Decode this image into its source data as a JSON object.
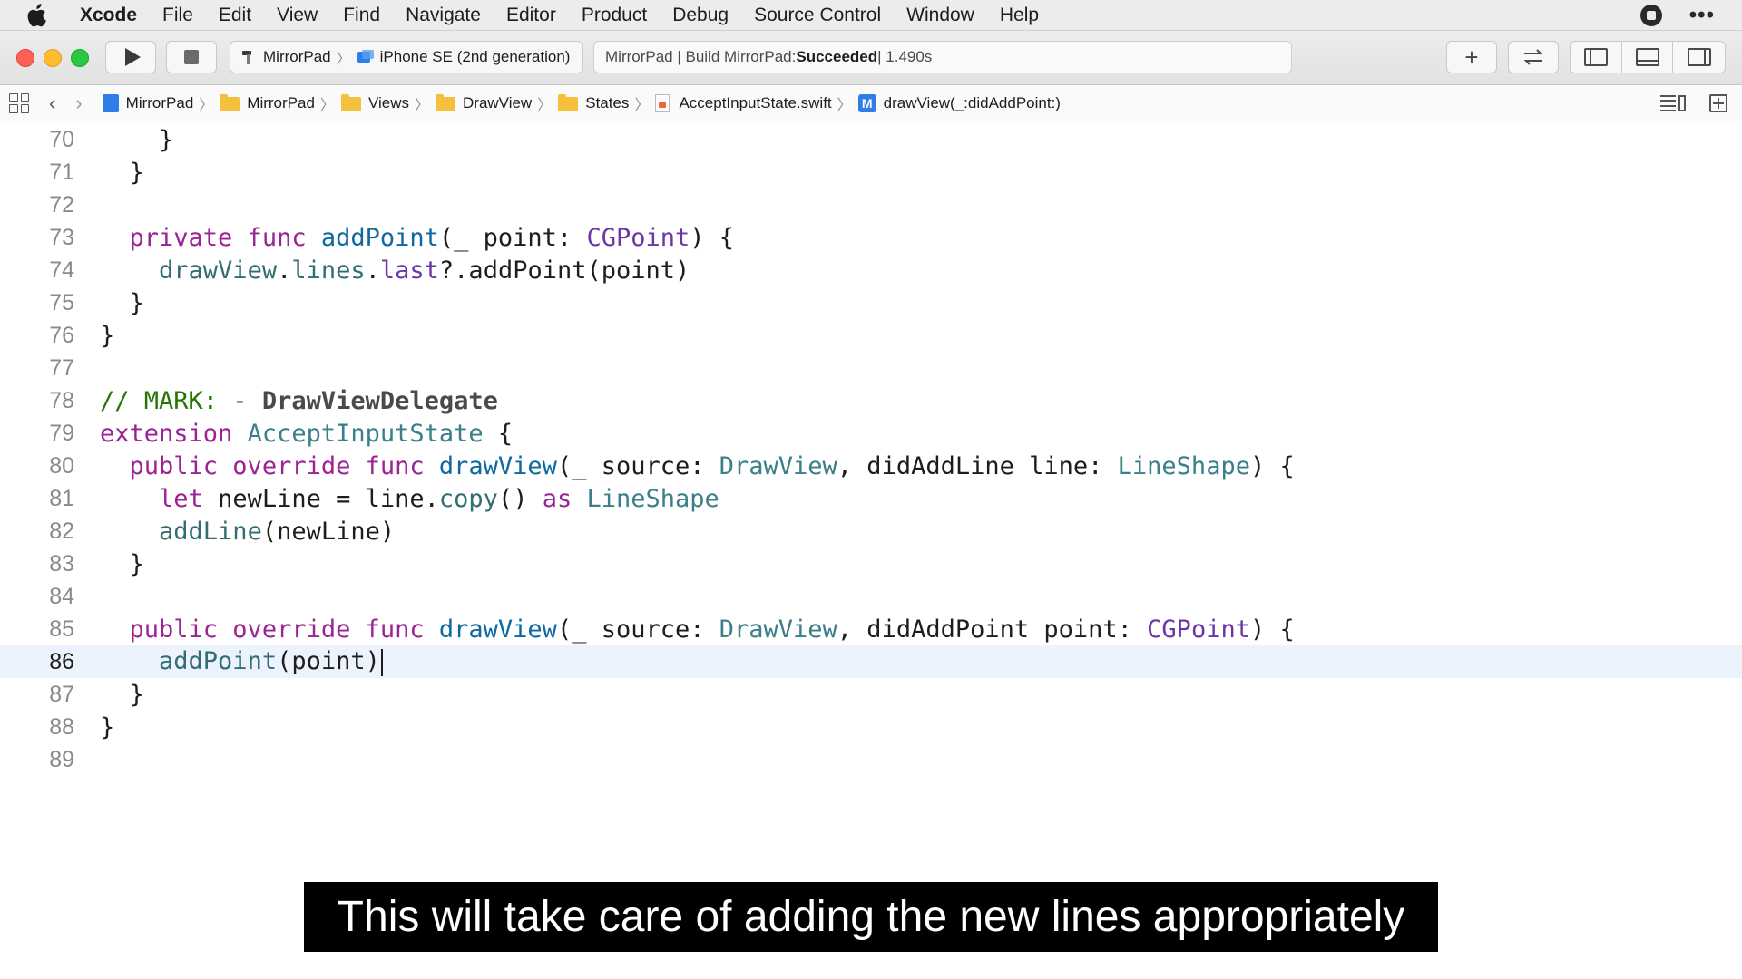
{
  "menubar": {
    "app": "Xcode",
    "items": [
      "File",
      "Edit",
      "View",
      "Find",
      "Navigate",
      "Editor",
      "Product",
      "Debug",
      "Source Control",
      "Window",
      "Help"
    ],
    "right_icons": [
      "record-icon",
      "more-icon"
    ]
  },
  "toolbar": {
    "scheme": "MirrorPad",
    "device": "iPhone SE (2nd generation)",
    "activity_prefix": "MirrorPad | Build MirrorPad: ",
    "activity_status": "Succeeded",
    "activity_time": " | 1.490s",
    "library_label": "+",
    "accent": "#2f7ee8"
  },
  "jumpbar": {
    "crumbs": [
      "MirrorPad",
      "MirrorPad",
      "Views",
      "DrawView",
      "States",
      "AcceptInputState.swift",
      "drawView(_:didAddPoint:)"
    ],
    "method_badge": "M"
  },
  "editor": {
    "current_line": 86,
    "lines": [
      {
        "n": "70"
      },
      {
        "n": "71"
      },
      {
        "n": "72"
      },
      {
        "n": "73"
      },
      {
        "n": "74"
      },
      {
        "n": "75"
      },
      {
        "n": "76"
      },
      {
        "n": "77"
      },
      {
        "n": "78"
      },
      {
        "n": "79"
      },
      {
        "n": "80"
      },
      {
        "n": "81"
      },
      {
        "n": "82"
      },
      {
        "n": "83"
      },
      {
        "n": "84"
      },
      {
        "n": "85"
      },
      {
        "n": "86"
      },
      {
        "n": "87"
      },
      {
        "n": "88"
      },
      {
        "n": "89"
      }
    ],
    "code": {
      "l70": "    }",
      "l71": "  }",
      "l73_kw": "private func ",
      "l73_fn": "addPoint",
      "l73_a": "(_ point: ",
      "l73_ty": "CGPoint",
      "l73_b": ") {",
      "l74_a": "drawView",
      "l74_b": ".",
      "l74_c": "lines",
      "l74_d": ".",
      "l74_e": "last",
      "l74_f": "?.addPoint(point)",
      "l75": "  }",
      "l76": "}",
      "l78_cm": "// MARK: - ",
      "l78_cmb": "DrawViewDelegate",
      "l79_kw": "extension ",
      "l79_ty": "AcceptInputState",
      "l79_b": " {",
      "l80_kw": "public override func ",
      "l80_fn": "drawView",
      "l80_a": "(_ source: ",
      "l80_ty1": "DrawView",
      "l80_b": ", didAddLine line: ",
      "l80_ty2": "LineShape",
      "l80_c": ") {",
      "l81_kw": "let",
      "l81_a": " newLine = line.",
      "l81_fn": "copy",
      "l81_b": "() ",
      "l81_kw2": "as",
      "l81_c": " ",
      "l81_ty": "LineShape",
      "l82_fn": "addLine",
      "l82_a": "(newLine)",
      "l83": "  }",
      "l85_kw": "public override func ",
      "l85_fn": "drawView",
      "l85_a": "(_ source: ",
      "l85_ty1": "DrawView",
      "l85_b": ", didAddPoint point: ",
      "l85_ty2": "CGPoint",
      "l85_c": ") {",
      "l86_fn": "addPoint",
      "l86_a": "(point)",
      "l87": "  }",
      "l88": "}"
    }
  },
  "caption": "This will take care of adding the new lines appropriately"
}
